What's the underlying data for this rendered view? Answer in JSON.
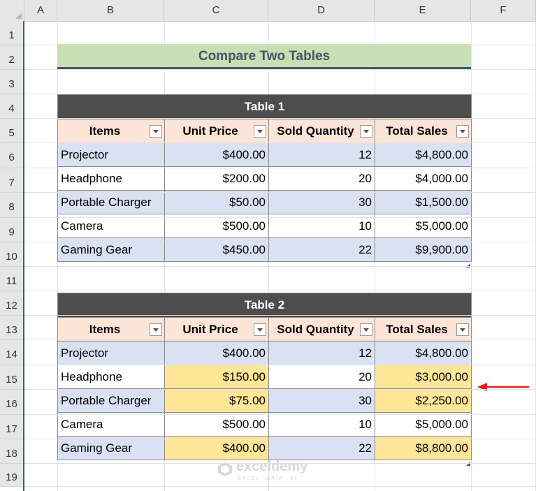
{
  "columns": [
    "A",
    "B",
    "C",
    "D",
    "E",
    "F"
  ],
  "rows": [
    "1",
    "2",
    "3",
    "4",
    "5",
    "6",
    "7",
    "8",
    "9",
    "10",
    "11",
    "12",
    "13",
    "14",
    "15",
    "16",
    "17",
    "18",
    "19"
  ],
  "title": "Compare Two Tables",
  "headers": [
    "Items",
    "Unit Price",
    "Sold Quantity",
    "Total Sales"
  ],
  "table1": {
    "caption": "Table 1",
    "rows": [
      [
        "Projector",
        "$400.00",
        "12",
        "$4,800.00"
      ],
      [
        "Headphone",
        "$200.00",
        "20",
        "$4,000.00"
      ],
      [
        "Portable Charger",
        "$50.00",
        "30",
        "$1,500.00"
      ],
      [
        "Camera",
        "$500.00",
        "10",
        "$5,000.00"
      ],
      [
        "Gaming Gear",
        "$450.00",
        "22",
        "$9,900.00"
      ]
    ]
  },
  "table2": {
    "caption": "Table 2",
    "rows": [
      [
        "Projector",
        "$400.00",
        "12",
        "$4,800.00"
      ],
      [
        "Headphone",
        "$150.00",
        "20",
        "$3,000.00"
      ],
      [
        "Portable Charger",
        "$75.00",
        "30",
        "$2,250.00"
      ],
      [
        "Camera",
        "$500.00",
        "10",
        "$5,000.00"
      ],
      [
        "Gaming Gear",
        "$400.00",
        "22",
        "$8,800.00"
      ]
    ]
  },
  "watermark": {
    "name": "exceldemy",
    "tagline": "EXCEL · DATA · BI"
  },
  "colors": {
    "title_bg": "#c6e0b4",
    "title_text": "#44546a",
    "caption_bg": "#4d4d4d",
    "header_bg": "#fce4d6",
    "band": "#d9e1f2",
    "highlight": "#ffe699",
    "arrow": "#e0201c"
  }
}
